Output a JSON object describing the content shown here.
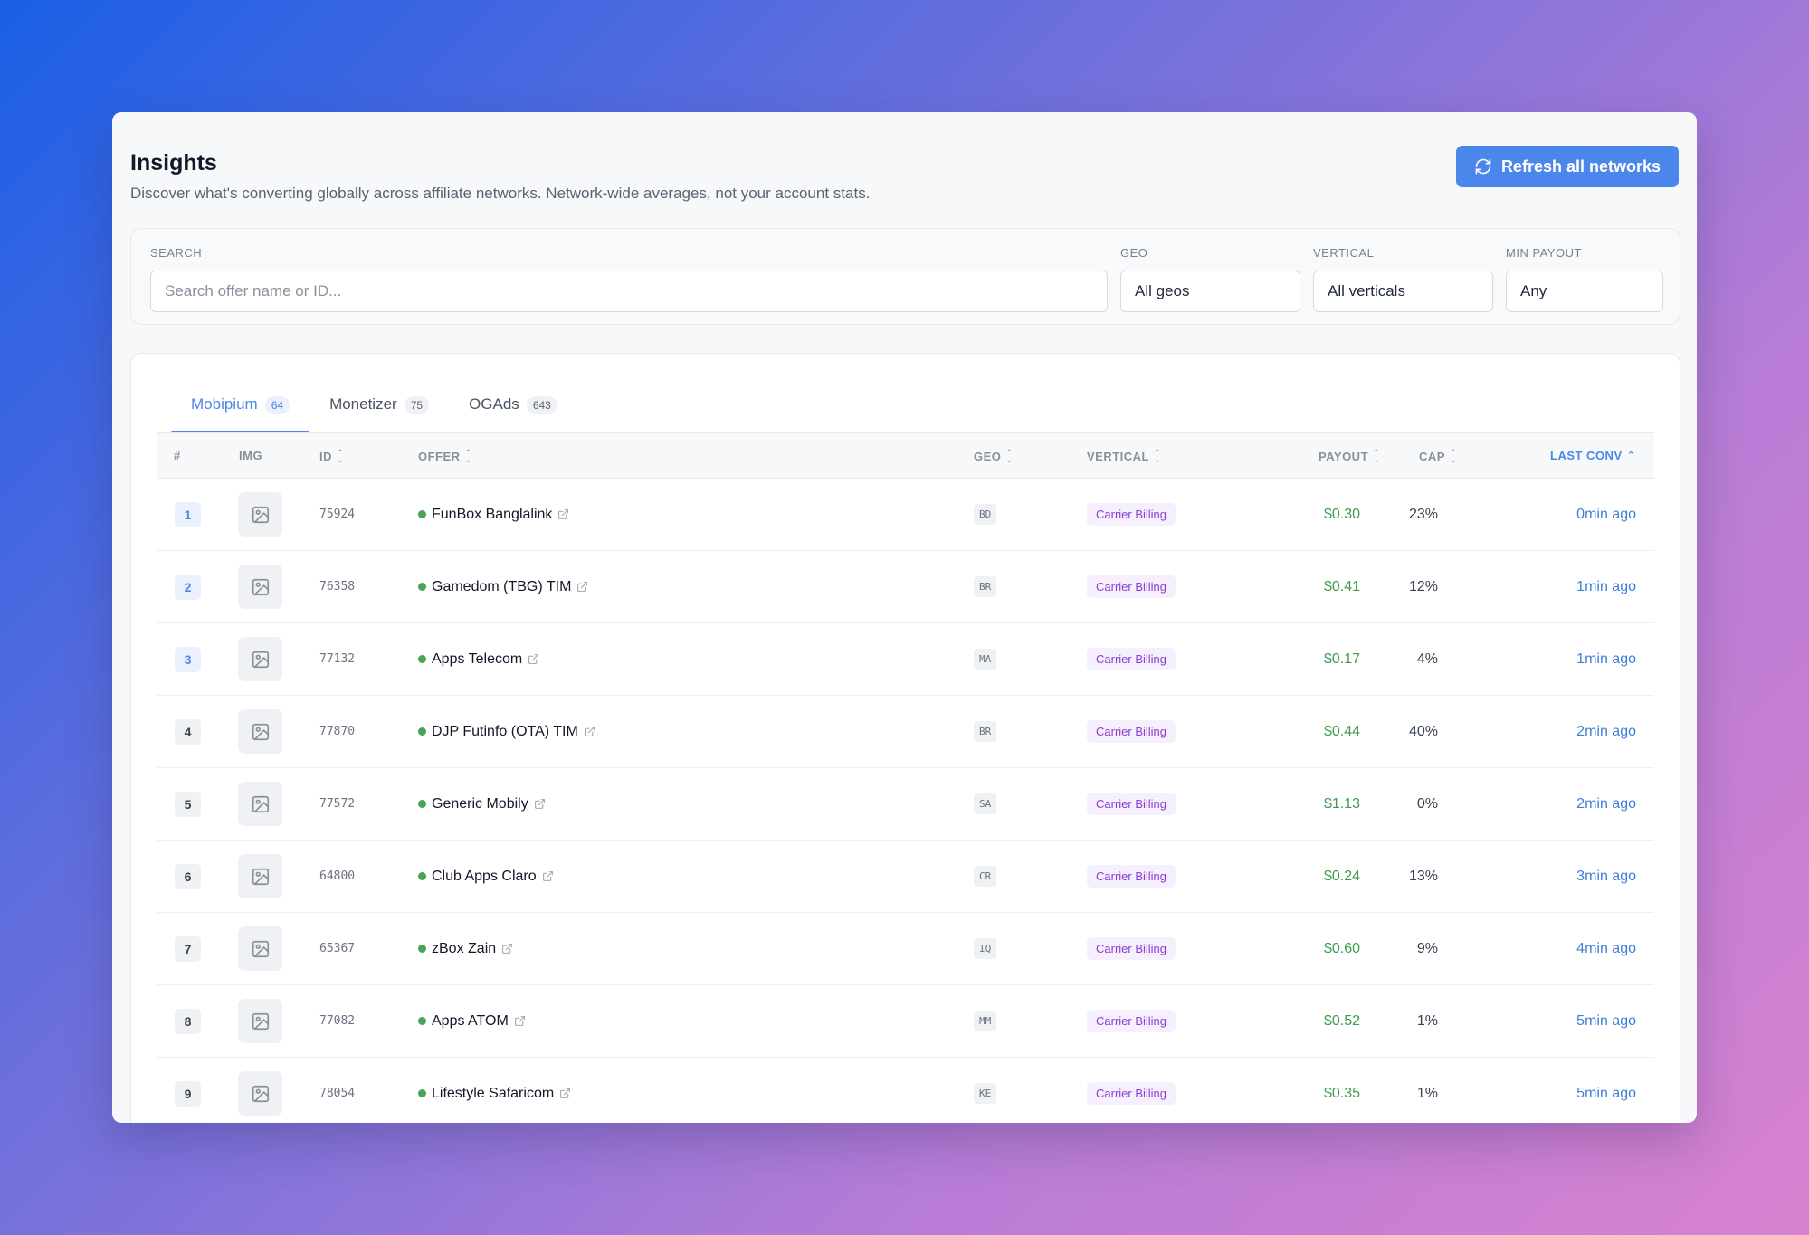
{
  "header": {
    "title": "Insights",
    "subtitle": "Discover what's converting globally across affiliate networks. Network-wide averages, not your account stats.",
    "refresh_label": "Refresh all networks",
    "refresh_icon": "refresh-icon"
  },
  "filters": {
    "search_label": "SEARCH",
    "search_placeholder": "Search offer name or ID...",
    "geo_label": "GEO",
    "geo_value": "All geos",
    "vertical_label": "VERTICAL",
    "vertical_value": "All verticals",
    "min_payout_label": "MIN PAYOUT",
    "min_payout_value": "Any"
  },
  "tabs": [
    {
      "label": "Mobipium",
      "count": "64",
      "active": true
    },
    {
      "label": "Monetizer",
      "count": "75",
      "active": false
    },
    {
      "label": "OGAds",
      "count": "643",
      "active": false
    }
  ],
  "columns": {
    "rank": "#",
    "img": "IMG",
    "id": "ID",
    "offer": "OFFER",
    "geo": "GEO",
    "vertical": "VERTICAL",
    "payout": "PAYOUT",
    "cap": "CAP",
    "last_conv": "LAST CONV"
  },
  "rows": [
    {
      "rank": "1",
      "id": "75924",
      "offer": "FunBox Banglalink",
      "geo": "BD",
      "vertical": "Carrier Billing",
      "payout": "$0.30",
      "cap": "23%",
      "last_conv": "0min ago"
    },
    {
      "rank": "2",
      "id": "76358",
      "offer": "Gamedom (TBG) TIM",
      "geo": "BR",
      "vertical": "Carrier Billing",
      "payout": "$0.41",
      "cap": "12%",
      "last_conv": "1min ago"
    },
    {
      "rank": "3",
      "id": "77132",
      "offer": "Apps Telecom",
      "geo": "MA",
      "vertical": "Carrier Billing",
      "payout": "$0.17",
      "cap": "4%",
      "last_conv": "1min ago"
    },
    {
      "rank": "4",
      "id": "77870",
      "offer": "DJP Futinfo (OTA) TIM",
      "geo": "BR",
      "vertical": "Carrier Billing",
      "payout": "$0.44",
      "cap": "40%",
      "last_conv": "2min ago"
    },
    {
      "rank": "5",
      "id": "77572",
      "offer": "Generic Mobily",
      "geo": "SA",
      "vertical": "Carrier Billing",
      "payout": "$1.13",
      "cap": "0%",
      "last_conv": "2min ago"
    },
    {
      "rank": "6",
      "id": "64800",
      "offer": "Club Apps Claro",
      "geo": "CR",
      "vertical": "Carrier Billing",
      "payout": "$0.24",
      "cap": "13%",
      "last_conv": "3min ago"
    },
    {
      "rank": "7",
      "id": "65367",
      "offer": "zBox Zain",
      "geo": "IQ",
      "vertical": "Carrier Billing",
      "payout": "$0.60",
      "cap": "9%",
      "last_conv": "4min ago"
    },
    {
      "rank": "8",
      "id": "77082",
      "offer": "Apps ATOM",
      "geo": "MM",
      "vertical": "Carrier Billing",
      "payout": "$0.52",
      "cap": "1%",
      "last_conv": "5min ago"
    },
    {
      "rank": "9",
      "id": "78054",
      "offer": "Lifestyle Safaricom",
      "geo": "KE",
      "vertical": "Carrier Billing",
      "payout": "$0.35",
      "cap": "1%",
      "last_conv": "5min ago"
    }
  ],
  "colors": {
    "accent": "#4b86ea",
    "payout": "#3f9b4e",
    "vertical_badge": "#8a3fd0",
    "status_dot": "#4aa35a"
  }
}
